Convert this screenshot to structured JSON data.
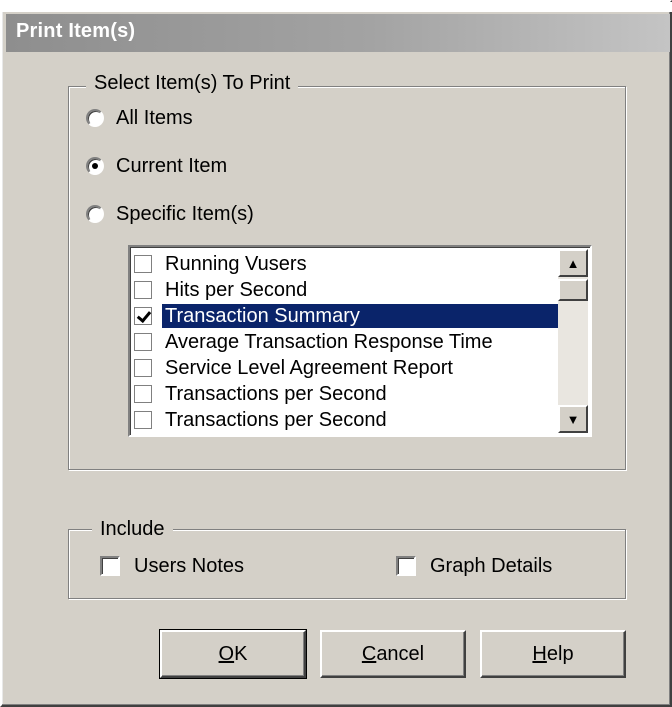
{
  "dialog": {
    "title": "Print Item(s)"
  },
  "select_group": {
    "legend": "Select Item(s) To Print",
    "options": [
      {
        "label": "All Items",
        "checked": false
      },
      {
        "label": "Current Item",
        "checked": true
      },
      {
        "label": "Specific Item(s)",
        "checked": false
      }
    ],
    "items": [
      {
        "label": "Running Vusers",
        "checked": false,
        "selected": false
      },
      {
        "label": "Hits per Second",
        "checked": false,
        "selected": false
      },
      {
        "label": "Transaction Summary",
        "checked": true,
        "selected": true
      },
      {
        "label": "Average Transaction Response Time",
        "checked": false,
        "selected": false
      },
      {
        "label": "Service Level Agreement Report",
        "checked": false,
        "selected": false
      },
      {
        "label": "Transactions per Second",
        "checked": false,
        "selected": false
      },
      {
        "label": "Transactions per Second",
        "checked": false,
        "selected": false
      }
    ]
  },
  "include_group": {
    "legend": "Include",
    "users_notes": {
      "label": "Users Notes",
      "checked": false
    },
    "graph_details": {
      "label": "Graph Details",
      "checked": false
    }
  },
  "buttons": {
    "ok": {
      "mnemonic": "O",
      "rest": "K"
    },
    "cancel": {
      "mnemonic": "C",
      "rest": "ancel"
    },
    "help": {
      "mnemonic": "H",
      "rest": "elp"
    }
  },
  "colors": {
    "face": "#d4d0c8",
    "selection": "#0a246a",
    "title_gradient_start": "#8e8e8e"
  }
}
